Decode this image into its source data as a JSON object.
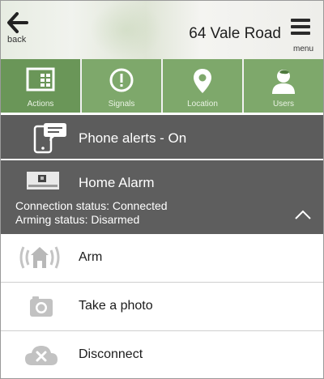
{
  "header": {
    "back_label": "back",
    "title": "64 Vale Road",
    "menu_label": "menu"
  },
  "tabs": [
    {
      "label": "Actions",
      "icon": "actions-grid-icon",
      "active": true
    },
    {
      "label": "Signals",
      "icon": "alert-circle-icon",
      "active": false
    },
    {
      "label": "Location",
      "icon": "location-pin-icon",
      "active": false
    },
    {
      "label": "Users",
      "icon": "user-icon",
      "active": false
    }
  ],
  "phone_alerts": {
    "label": "Phone alerts - On",
    "icon": "phone-message-icon"
  },
  "device": {
    "name": "Home Alarm",
    "connection_status": "Connection status: Connected",
    "arming_status": "Arming status: Disarmed",
    "icon": "alarm-panel-icon"
  },
  "actions": [
    {
      "label": "Arm",
      "icon": "house-signal-icon"
    },
    {
      "label": "Take a photo",
      "icon": "camera-icon"
    },
    {
      "label": "Disconnect",
      "icon": "cloud-disconnect-icon"
    }
  ],
  "colors": {
    "tab_green": "#7ea86b",
    "tab_active_green": "#6a9658",
    "dark_row": "#5c5c5c",
    "icon_gray": "#bdbdbd"
  }
}
